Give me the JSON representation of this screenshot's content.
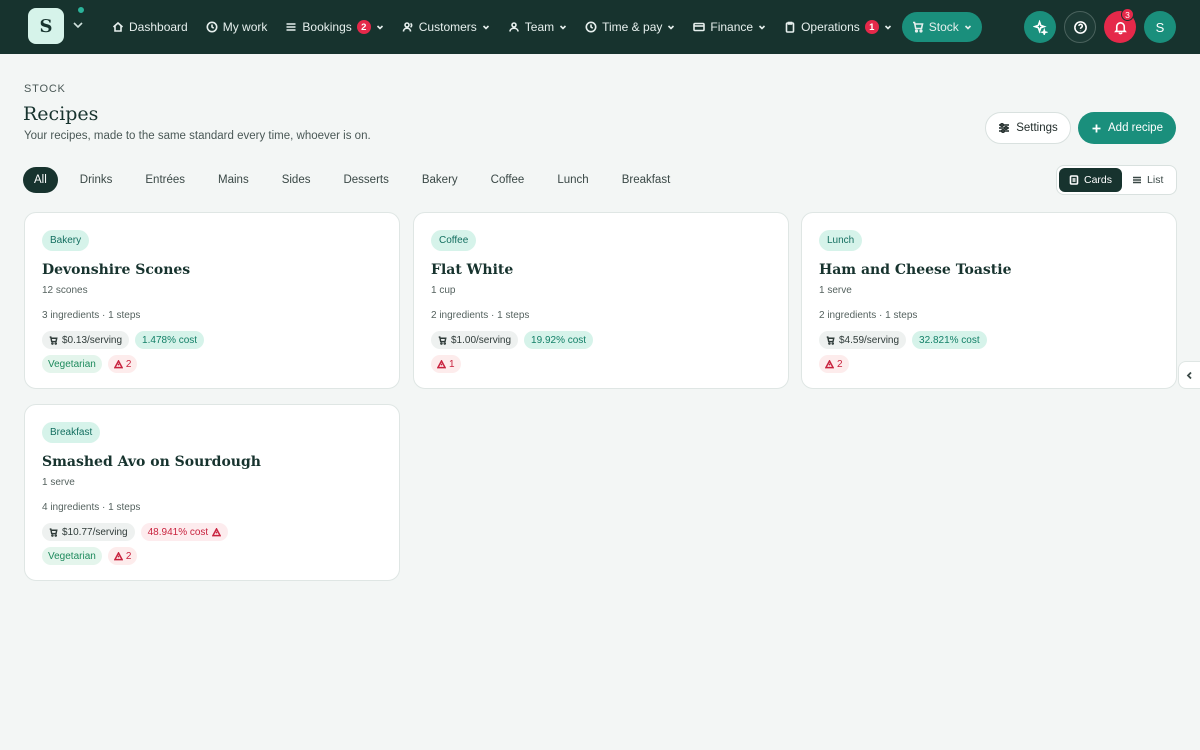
{
  "brand": {
    "logo_letter": "S"
  },
  "nav": {
    "items": [
      {
        "label": "Dashboard",
        "icon": "home-icon"
      },
      {
        "label": "My work",
        "icon": "clock-icon"
      },
      {
        "label": "Bookings",
        "icon": "list-icon",
        "badge": "2",
        "dropdown": true
      },
      {
        "label": "Customers",
        "icon": "users-icon",
        "dropdown": true
      },
      {
        "label": "Team",
        "icon": "team-icon",
        "dropdown": true
      },
      {
        "label": "Time & pay",
        "icon": "clock-icon",
        "dropdown": true
      },
      {
        "label": "Finance",
        "icon": "card-icon",
        "dropdown": true
      },
      {
        "label": "Operations",
        "icon": "clipboard-icon",
        "badge": "1",
        "dropdown": true
      },
      {
        "label": "Stock",
        "icon": "cart-icon",
        "dropdown": true,
        "active": true
      }
    ],
    "notifications_count": "3",
    "avatar_letter": "S"
  },
  "header": {
    "eyebrow": "STOCK",
    "title": "Recipes",
    "subtitle": "Your recipes, made to the same standard every time, whoever is on.",
    "settings_label": "Settings",
    "add_label": "Add recipe"
  },
  "filters": [
    "All",
    "Drinks",
    "Entrées",
    "Mains",
    "Sides",
    "Desserts",
    "Bakery",
    "Coffee",
    "Lunch",
    "Breakfast"
  ],
  "view_toggle": {
    "cards": "Cards",
    "list": "List",
    "selected": "Cards"
  },
  "recipes": [
    {
      "category": "Bakery",
      "name": "Devonshire Scones",
      "yield": "12 scones",
      "meta": "3 ingredients · 1 steps",
      "cost_per_serving": "$0.13/serving",
      "cost_pct": "1.478% cost",
      "cost_alert": false,
      "vegetarian": "Vegetarian",
      "warnings": "2"
    },
    {
      "category": "Coffee",
      "name": "Flat White",
      "yield": "1 cup",
      "meta": "2 ingredients · 1 steps",
      "cost_per_serving": "$1.00/serving",
      "cost_pct": "19.92% cost",
      "cost_alert": false,
      "vegetarian": "",
      "warnings": "1"
    },
    {
      "category": "Lunch",
      "name": "Ham and Cheese Toastie",
      "yield": "1 serve",
      "meta": "2 ingredients · 1 steps",
      "cost_per_serving": "$4.59/serving",
      "cost_pct": "32.821% cost",
      "cost_alert": false,
      "vegetarian": "",
      "warnings": "2"
    },
    {
      "category": "Breakfast",
      "name": "Smashed Avo on Sourdough",
      "yield": "1 serve",
      "meta": "4 ingredients · 1 steps",
      "cost_per_serving": "$10.77/serving",
      "cost_pct": "48.941% cost",
      "cost_alert": true,
      "vegetarian": "Vegetarian",
      "warnings": "2"
    }
  ]
}
